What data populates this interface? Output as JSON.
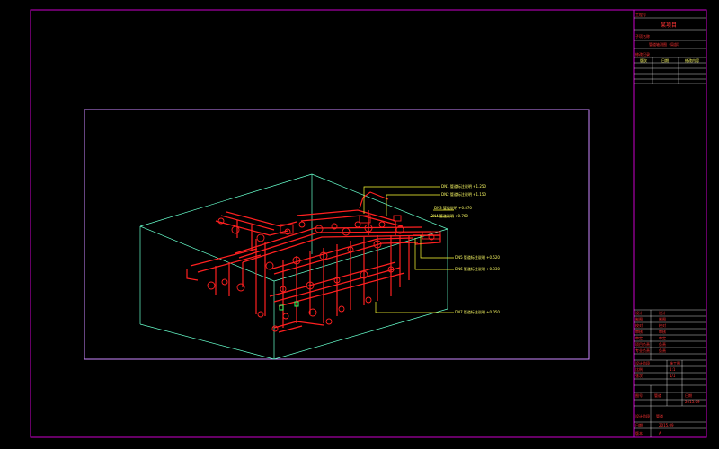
{
  "title_block": {
    "header_label": "工程号",
    "project_name": "某项目",
    "section_label": "子项名称",
    "drawing_title": "管道轴测图（局部）",
    "revision_label": "修改记录",
    "revision_columns": [
      "版次",
      "日期",
      "修改内容"
    ],
    "signature_rows": [
      {
        "label": "设计",
        "value": "设计"
      },
      {
        "label": "制图",
        "value": "制图"
      },
      {
        "label": "校对",
        "value": "校对"
      },
      {
        "label": "审核",
        "value": "审核"
      },
      {
        "label": "审定",
        "value": "审定"
      },
      {
        "label": "项目负责",
        "value": "负责"
      },
      {
        "label": "专业负责",
        "value": "负责"
      }
    ],
    "stage_label": "设计阶段",
    "stage_value": "施工图",
    "scale_label": "比例",
    "scale_value": "1:1",
    "sheet_label": "张次",
    "sheet_value": "1/1",
    "drawing_no_label": "图号",
    "drawing_no_value": "管道",
    "date_label": "日期",
    "date_value": "2015.09",
    "bottom_label": "版本",
    "bottom_value": "A"
  },
  "callouts": [
    {
      "text": "DN1 管道标注说明  +1.250"
    },
    {
      "text": "DN2 管道标注说明  +1.150"
    },
    {
      "text": "DN3 管道说明  +0.870"
    },
    {
      "text": "DN4 管道说明  +0.760"
    },
    {
      "text": "DN5 管道标注说明  +0.520"
    },
    {
      "text": "DN6 管道标注说明  +0.330"
    },
    {
      "text": "DN7 管道标注说明  +0.050"
    }
  ],
  "colors": {
    "frame": "#cc00cc",
    "viewport": "#cc88ff",
    "box": "#66ffcc",
    "pipes": "#ff2020",
    "leaders": "#ffff33",
    "grid": "#ffffff"
  }
}
